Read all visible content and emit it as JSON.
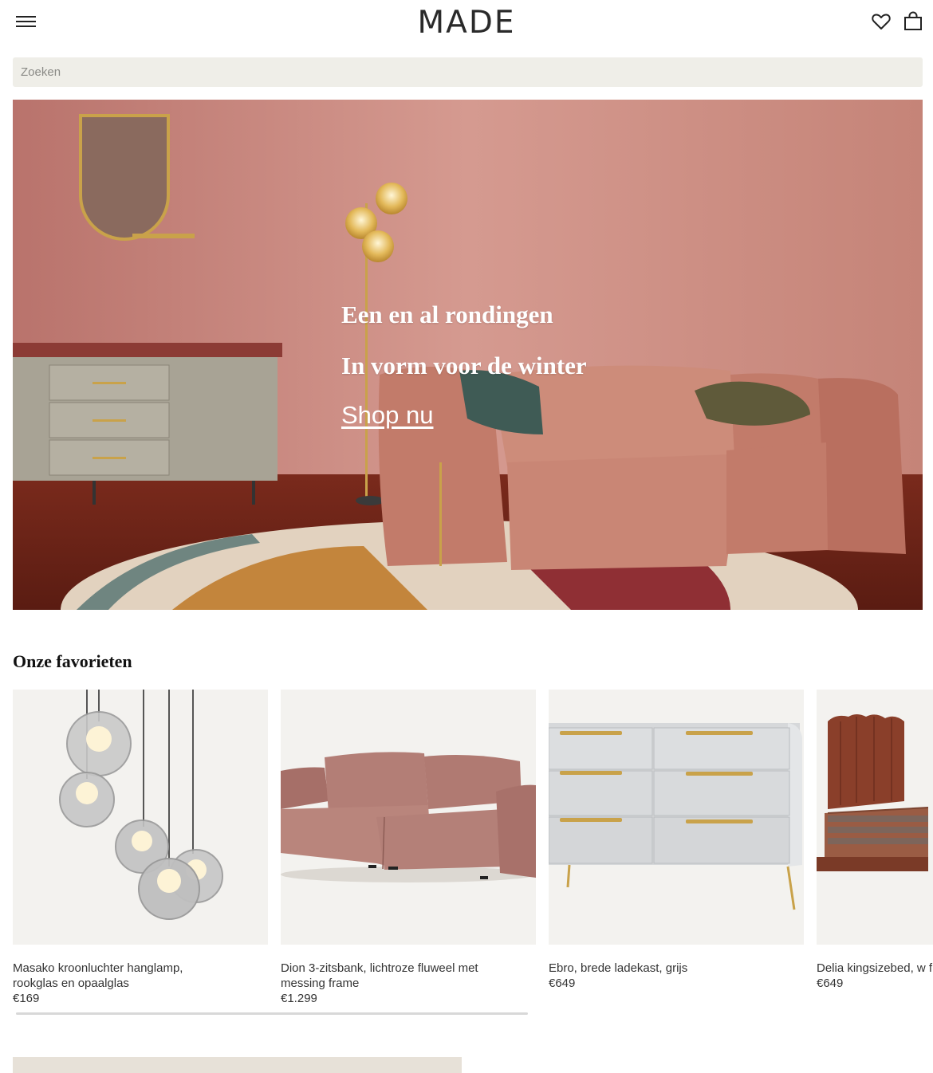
{
  "header": {
    "logo": "MADE",
    "menu_icon": "hamburger-menu-icon",
    "wishlist_icon": "heart-icon",
    "cart_icon": "shopping-bag-icon"
  },
  "search": {
    "placeholder": "Zoeken"
  },
  "hero": {
    "heading": "Een en al rondingen",
    "subheading": "In vorm voor de winter",
    "cta": "Shop nu"
  },
  "favorites": {
    "title": "Onze favorieten",
    "products": [
      {
        "name": "Masako kroonluchter hanglamp, rookglas en opaalglas",
        "price": "€169"
      },
      {
        "name": "Dion 3-zitsbank, lichtroze fluweel met messing frame",
        "price": "€1.299"
      },
      {
        "name": "Ebro, brede ladekast, grijs",
        "price": "€649"
      },
      {
        "name": "Delia kingsizebed, w fluweel",
        "price": "€649"
      }
    ]
  }
}
